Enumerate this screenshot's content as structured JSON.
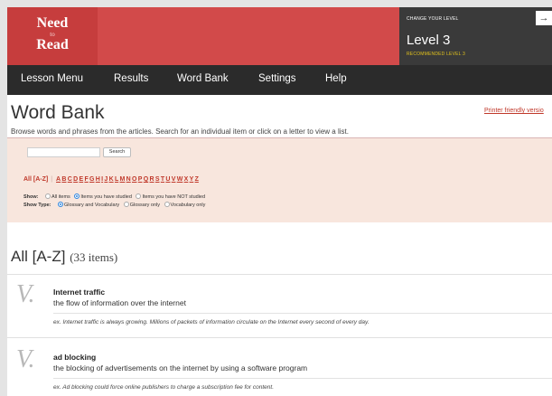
{
  "logo": {
    "line1": "Need",
    "line2": "to",
    "line3": "Read"
  },
  "level": {
    "change_label": "CHANGE YOUR LEVEL",
    "arrow_icon": "arrow-right-icon",
    "current": "Level 3",
    "recommended": "RECOMMENDED LEVEL 3"
  },
  "nav": {
    "items": [
      "Lesson Menu",
      "Results",
      "Word Bank",
      "Settings",
      "Help"
    ]
  },
  "page": {
    "title": "Word Bank",
    "printer_link": "Printer friendly versio",
    "intro": "Browse words and phrases from the articles. Search for an individual item or click on a letter to view a list."
  },
  "search": {
    "value": "",
    "button": "Search"
  },
  "letters": {
    "all": "All [A-Z]",
    "sep": "|",
    "items": [
      "A",
      "B",
      "C",
      "D",
      "E",
      "F",
      "G",
      "H",
      "I",
      "J",
      "K",
      "L",
      "M",
      "N",
      "O",
      "P",
      "Q",
      "R",
      "S",
      "T",
      "U",
      "V",
      "W",
      "X",
      "Y",
      "Z"
    ]
  },
  "filters": {
    "show": {
      "label": "Show:",
      "options": [
        "All items",
        "Items you have studied",
        "Items you have NOT studied"
      ],
      "selected": 1
    },
    "show_type": {
      "label": "Show Type:",
      "options": [
        "Glossary and Vocabulary",
        "Glossary only",
        "Vocabulary only"
      ],
      "selected": 0
    }
  },
  "results": {
    "title": "All [A-Z]",
    "count": "(33 items)"
  },
  "entries": [
    {
      "mark": "V.",
      "term": "Internet traffic",
      "definition": "the flow of information over the internet",
      "example": "ex. Internet traffic is always growing. Millions of packets of information circulate on the Internet every second of every day."
    },
    {
      "mark": "V.",
      "term": "ad blocking",
      "definition": "the blocking of advertisements on the internet by using a software program",
      "example": "ex. Ad blocking could force online publishers to charge a subscription fee for content."
    }
  ],
  "colors": {
    "header": "#d24a4a",
    "logo": "#c63d3d",
    "level_box": "#3a3a3a",
    "nav": "#2b2b2b",
    "link": "#c0392b",
    "panel": "#f8e6dd",
    "radio_selected": "#2e86de",
    "recommended": "#e2c21c"
  }
}
